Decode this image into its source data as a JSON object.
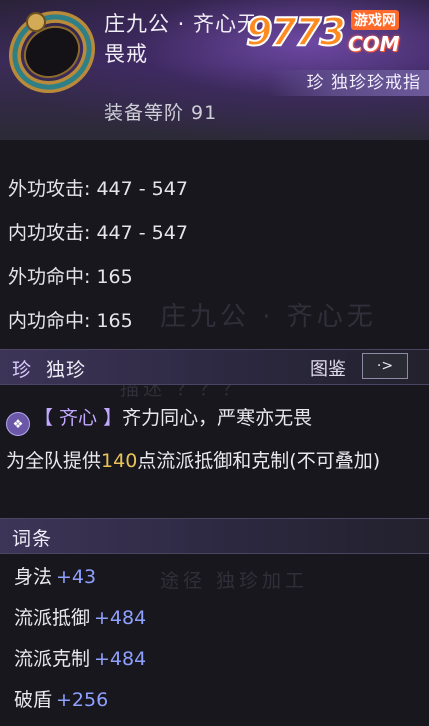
{
  "item": {
    "name_line1": "庄九公 · 齐心无",
    "name_line2": "畏戒",
    "rarity_tag": "珍 独珍珍戒指",
    "gear_level": "装备等阶 91"
  },
  "watermark": {
    "digits": "9773",
    "site": "游戏网",
    "com": "COM"
  },
  "stats": [
    {
      "label": "外功攻击",
      "value": "447 - 547"
    },
    {
      "label": "内功攻击",
      "value": "447 - 547"
    },
    {
      "label": "外功命中",
      "value": "165"
    },
    {
      "label": "内功命中",
      "value": "165"
    }
  ],
  "unique_section": {
    "gem": "珍",
    "title": "独珍",
    "codex_label": "图鉴",
    "codex_button": "·>"
  },
  "effect": {
    "icon": "❖",
    "name": "【 齐心 】",
    "summary": "齐力同心，严寒亦无畏",
    "text_before": "为全队提供",
    "amount": "140",
    "text_after": "点流派抵御和克制(不可叠加)"
  },
  "affix_section": {
    "title": "词条"
  },
  "affixes": [
    {
      "label": "身法",
      "value": "+43"
    },
    {
      "label": "流派抵御",
      "value": "+484"
    },
    {
      "label": "流派克制",
      "value": "+484"
    },
    {
      "label": "破盾",
      "value": "+256"
    }
  ],
  "ghost_text": {
    "name": "庄九公 · 齐心无",
    "desc": "描述 ？？？",
    "source": "途径  独珍加工",
    "source2": "途径 独珍加工"
  },
  "colors": {
    "effect_name": "#c2a8ff",
    "amount": "#e9c35a",
    "affix_value": "#8fa0ff"
  }
}
